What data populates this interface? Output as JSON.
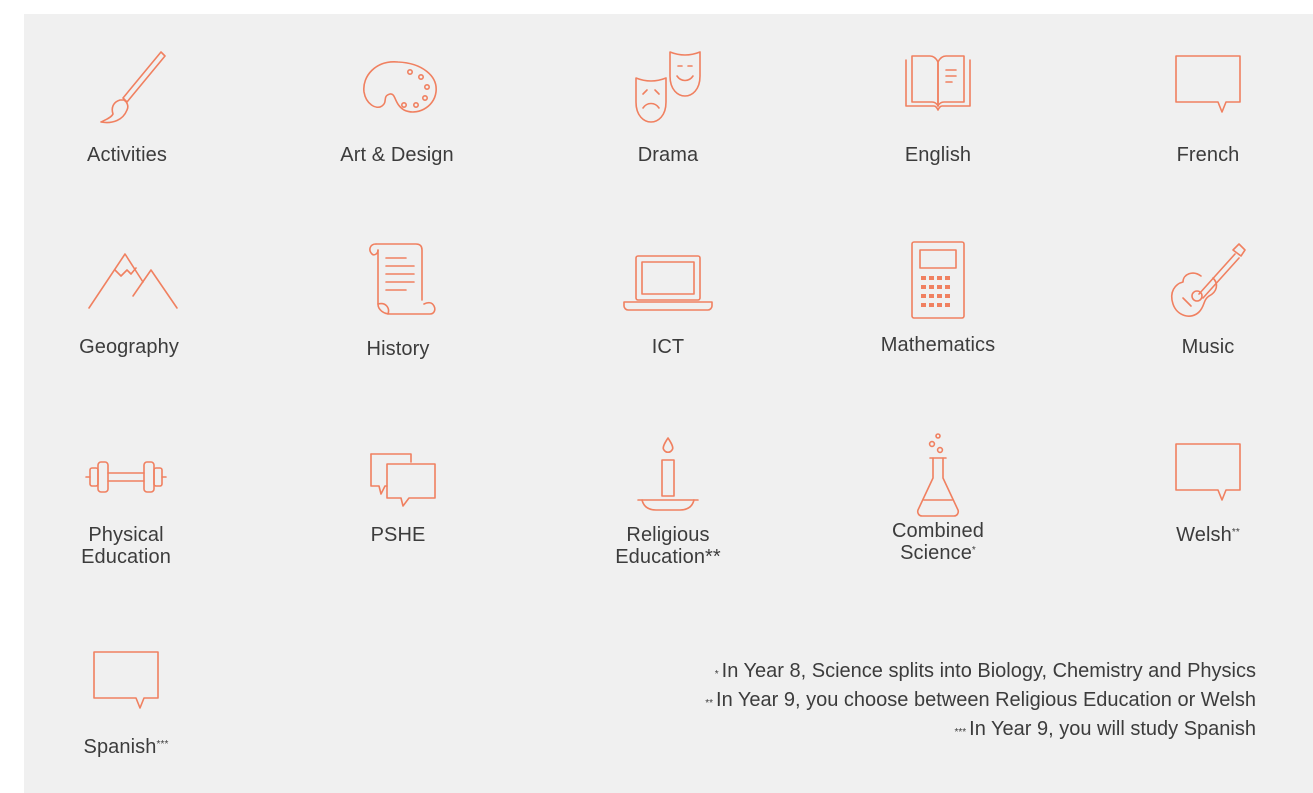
{
  "subjects": [
    {
      "label": "Activities",
      "icon": "paintbrush-icon"
    },
    {
      "label": "Art & Design",
      "icon": "palette-icon"
    },
    {
      "label": "Drama",
      "icon": "theatre-masks-icon"
    },
    {
      "label": "English",
      "icon": "open-book-icon"
    },
    {
      "label": "French",
      "icon": "speech-bubble-icon"
    },
    {
      "label": "Geography",
      "icon": "mountains-icon"
    },
    {
      "label": "History",
      "icon": "scroll-icon"
    },
    {
      "label": "ICT",
      "icon": "laptop-icon"
    },
    {
      "label": "Mathematics",
      "icon": "calculator-icon"
    },
    {
      "label": "Music",
      "icon": "guitar-icon"
    },
    {
      "label_line1": "Physical",
      "label_line2": "Education",
      "icon": "dumbbell-icon"
    },
    {
      "label": "PSHE",
      "icon": "chat-bubbles-icon"
    },
    {
      "label_line1": "Religious",
      "label_line2": "Education**",
      "icon": "candle-icon"
    },
    {
      "label_line1": "Combined",
      "label_line2": "Science",
      "sup": "*",
      "icon": "flask-icon"
    },
    {
      "label": "Welsh",
      "sup": "**",
      "icon": "speech-bubble-icon"
    },
    {
      "label": "Spanish",
      "sup": "***",
      "icon": "speech-bubble-icon"
    }
  ],
  "notes": [
    {
      "mark": "*",
      "text": "In Year 8, Science splits into Biology, Chemistry and Physics"
    },
    {
      "mark": "**",
      "text": "In Year 9, you choose between Religious Education or Welsh"
    },
    {
      "mark": "***",
      "text": "In Year 9, you will study Spanish"
    }
  ],
  "colors": {
    "accent": "#f08060",
    "panel": "#f0f0f0",
    "text": "#3c3c3c"
  }
}
